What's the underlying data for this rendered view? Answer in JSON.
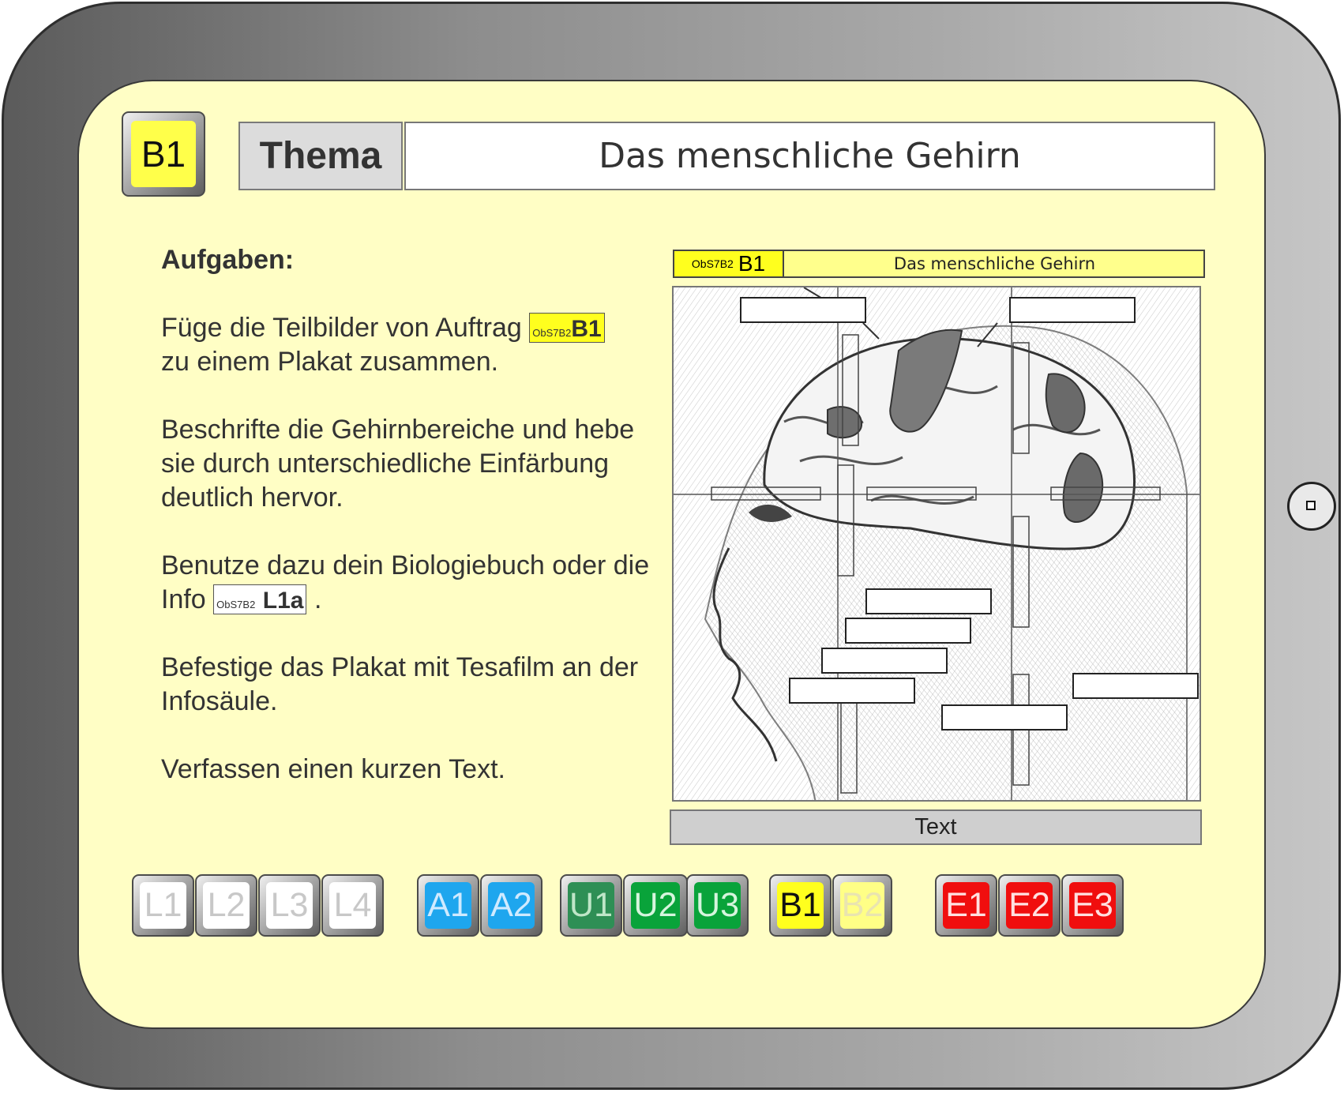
{
  "header": {
    "badge": "B1",
    "thema_label": "Thema",
    "title": "Das menschliche Gehirn"
  },
  "tasks": {
    "heading": "Aufgaben:",
    "p1_text": "Füge die Teilbilder von Auftrag",
    "p1_tag_code": "ObS7B2",
    "p1_tag_id": "B1",
    "p1_tail": "zu einem Plakat zusammen.",
    "p2": "Beschrifte die Gehirnbereiche und hebe sie durch unterschiedliche Einfärbung deutlich hervor.",
    "p3_text": "Benutze dazu dein Biologiebuch oder die Info",
    "p3_tag_code": "ObS7B2",
    "p3_tag_id": "L1a",
    "p3_tail": ".",
    "p4": "Befestige das Plakat mit Tesafilm an der Infosäule.",
    "p5": "Verfassen einen kurzen Text."
  },
  "poster": {
    "code": "ObS7B2",
    "id": "B1",
    "title": "Das menschliche Gehirn",
    "text_label": "Text"
  },
  "nav": {
    "buttons": [
      {
        "label": "L1",
        "color": "#ffffff",
        "text": "#c8c8c8"
      },
      {
        "label": "L2",
        "color": "#ffffff",
        "text": "#c8c8c8"
      },
      {
        "label": "L3",
        "color": "#ffffff",
        "text": "#c8c8c8"
      },
      {
        "label": "L4",
        "color": "#ffffff",
        "text": "#c8c8c8"
      },
      {
        "label": "A1",
        "color": "#1ea6ee",
        "text": "#cfeaff"
      },
      {
        "label": "A2",
        "color": "#1ea6ee",
        "text": "#cfeaff"
      },
      {
        "label": "U1",
        "color": "#2e8f55",
        "text": "#bfe6c8"
      },
      {
        "label": "U2",
        "color": "#09a33a",
        "text": "#d6f5dd"
      },
      {
        "label": "U3",
        "color": "#09a33a",
        "text": "#d6f5dd"
      },
      {
        "label": "B1",
        "color": "#ffff1e",
        "text": "#111111"
      },
      {
        "label": "B2",
        "color": "#ffff86",
        "text": "#e9e4b0"
      },
      {
        "label": "E1",
        "color": "#f00e0e",
        "text": "#ffe0e0"
      },
      {
        "label": "E2",
        "color": "#f00e0e",
        "text": "#ffe0e0"
      },
      {
        "label": "E3",
        "color": "#f00e0e",
        "text": "#ffe0e0"
      }
    ]
  },
  "colors": {
    "screen_bg": "#fffec5",
    "accent_yellow": "#ffff1e"
  }
}
